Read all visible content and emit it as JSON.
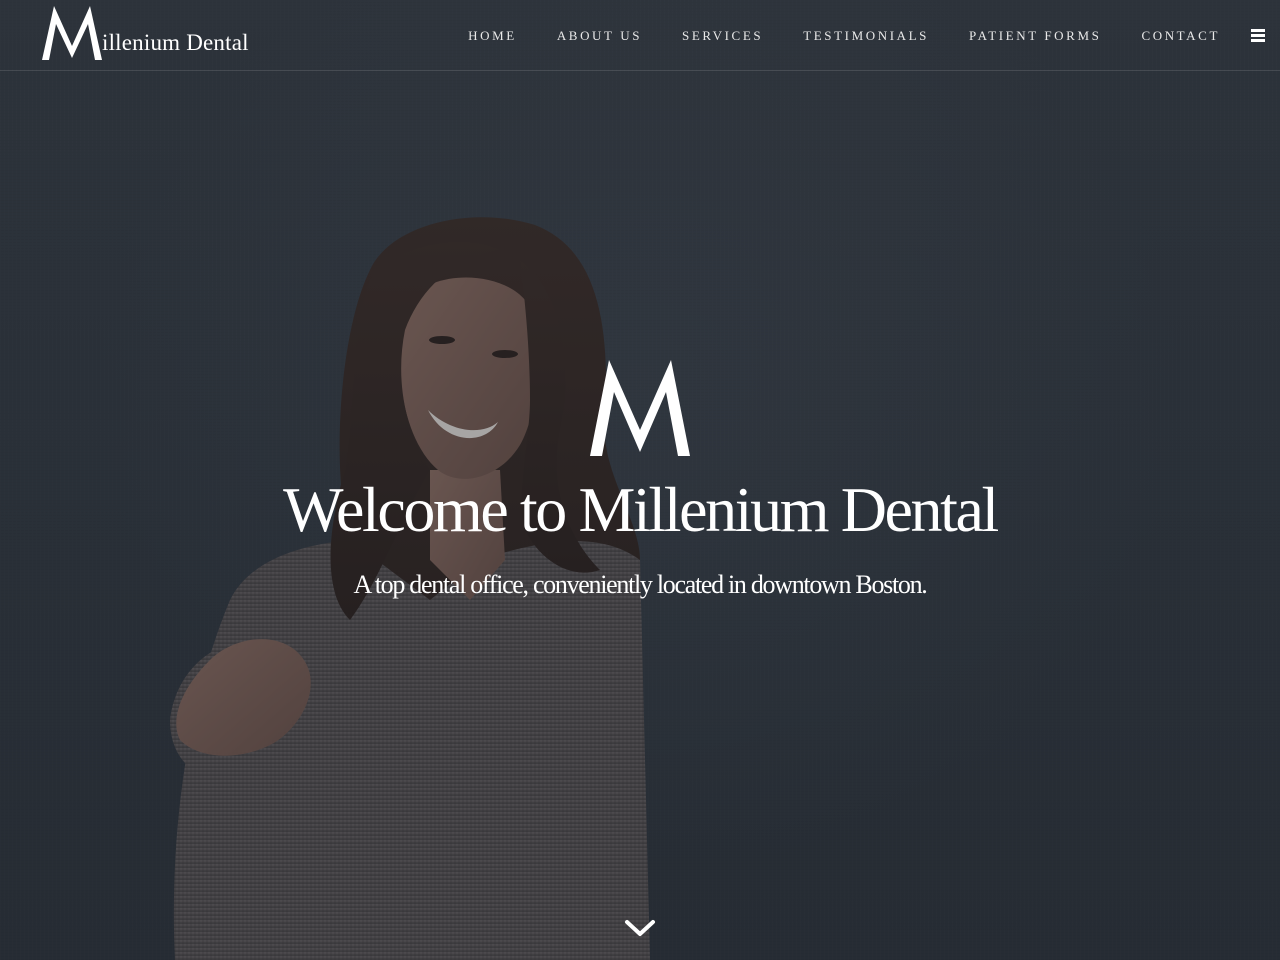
{
  "brand": {
    "logo_letter": "M",
    "logo_text": "illenium Dental",
    "accent": "#ffffff",
    "background": "#2f353e"
  },
  "nav": {
    "items": [
      {
        "label": "HOME"
      },
      {
        "label": "ABOUT US"
      },
      {
        "label": "SERVICES"
      },
      {
        "label": "TESTIMONIALS"
      },
      {
        "label": "PATIENT FORMS"
      },
      {
        "label": "CONTACT"
      }
    ],
    "menu_icon": "hamburger-icon"
  },
  "hero": {
    "mark_letter": "M",
    "title": "Welcome to Millenium Dental",
    "subtitle": "A top dental office, conveniently located in downtown Boston.",
    "scroll_icon": "chevron-down-icon",
    "image": "smiling-woman-photo"
  }
}
